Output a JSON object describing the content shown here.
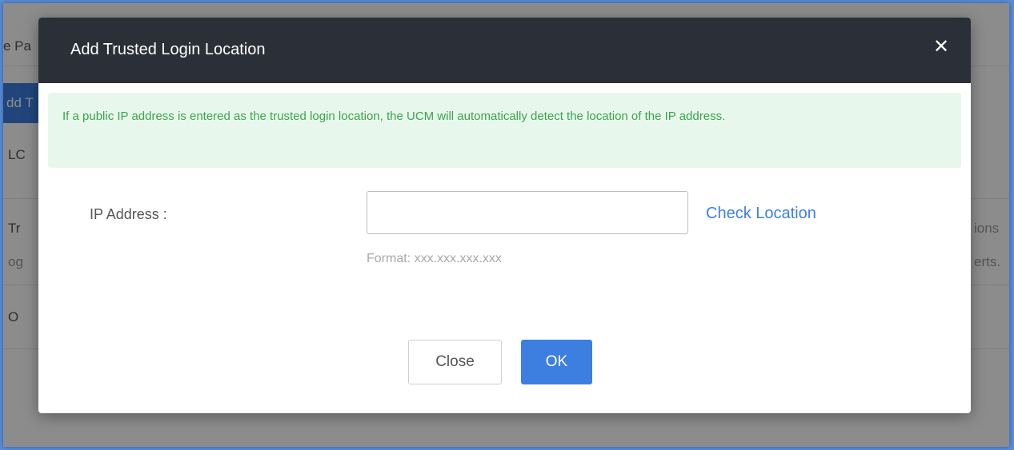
{
  "background": {
    "texts": [
      "e Pa",
      "dd T",
      "LC",
      "Tr",
      "og",
      "O",
      "ions",
      "erts."
    ]
  },
  "modal": {
    "title": "Add Trusted Login Location",
    "close_glyph": "✕",
    "alert_text": "If a public IP address is entered as the trusted login location, the UCM will automatically detect the location of the IP address.",
    "ip_label": "IP Address :",
    "ip_value": "",
    "check_location_label": "Check Location",
    "format_hint": "Format: xxx.xxx.xxx.xxx",
    "close_button_label": "Close",
    "ok_button_label": "OK"
  },
  "colors": {
    "header_bg": "#2b2f38",
    "alert_bg": "#e8f7ec",
    "alert_text": "#3aa54e",
    "accent": "#3d7fe0"
  },
  "icons": {
    "close": "close-icon"
  }
}
